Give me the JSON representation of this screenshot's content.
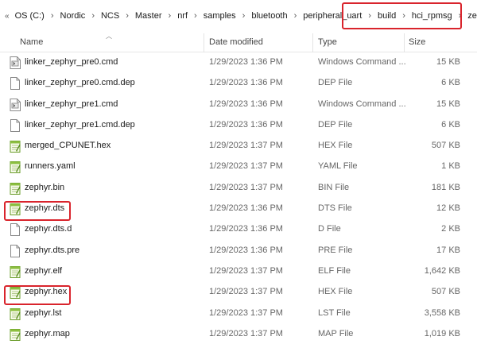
{
  "breadcrumb": {
    "back_glyph": "«",
    "items": [
      "OS (C:)",
      "Nordic",
      "NCS",
      "Master",
      "nrf",
      "samples",
      "bluetooth",
      "peripheral_uart",
      "build",
      "hci_rpmsg",
      "zephyr"
    ]
  },
  "columns": {
    "name": "Name",
    "date": "Date modified",
    "type": "Type",
    "size": "Size"
  },
  "files": [
    {
      "name": "linker_zephyr_pre0.cmd",
      "date": "1/29/2023 1:36 PM",
      "type": "Windows Command ...",
      "size": "15 KB",
      "icon": "cmd-file-icon"
    },
    {
      "name": "linker_zephyr_pre0.cmd.dep",
      "date": "1/29/2023 1:36 PM",
      "type": "DEP File",
      "size": "6 KB",
      "icon": "blank-file-icon"
    },
    {
      "name": "linker_zephyr_pre1.cmd",
      "date": "1/29/2023 1:36 PM",
      "type": "Windows Command ...",
      "size": "15 KB",
      "icon": "cmd-file-icon"
    },
    {
      "name": "linker_zephyr_pre1.cmd.dep",
      "date": "1/29/2023 1:36 PM",
      "type": "DEP File",
      "size": "6 KB",
      "icon": "blank-file-icon"
    },
    {
      "name": "merged_CPUNET.hex",
      "date": "1/29/2023 1:37 PM",
      "type": "HEX File",
      "size": "507 KB",
      "icon": "notepadpp-file-icon"
    },
    {
      "name": "runners.yaml",
      "date": "1/29/2023 1:37 PM",
      "type": "YAML File",
      "size": "1 KB",
      "icon": "notepadpp-file-icon"
    },
    {
      "name": "zephyr.bin",
      "date": "1/29/2023 1:37 PM",
      "type": "BIN File",
      "size": "181 KB",
      "icon": "notepadpp-file-icon"
    },
    {
      "name": "zephyr.dts",
      "date": "1/29/2023 1:36 PM",
      "type": "DTS File",
      "size": "12 KB",
      "icon": "notepadpp-file-icon"
    },
    {
      "name": "zephyr.dts.d",
      "date": "1/29/2023 1:36 PM",
      "type": "D File",
      "size": "2 KB",
      "icon": "blank-file-icon"
    },
    {
      "name": "zephyr.dts.pre",
      "date": "1/29/2023 1:36 PM",
      "type": "PRE File",
      "size": "17 KB",
      "icon": "blank-file-icon"
    },
    {
      "name": "zephyr.elf",
      "date": "1/29/2023 1:37 PM",
      "type": "ELF File",
      "size": "1,642 KB",
      "icon": "notepadpp-file-icon"
    },
    {
      "name": "zephyr.hex",
      "date": "1/29/2023 1:37 PM",
      "type": "HEX File",
      "size": "507 KB",
      "icon": "notepadpp-file-icon"
    },
    {
      "name": "zephyr.lst",
      "date": "1/29/2023 1:37 PM",
      "type": "LST File",
      "size": "3,558 KB",
      "icon": "notepadpp-file-icon"
    },
    {
      "name": "zephyr.map",
      "date": "1/29/2023 1:37 PM",
      "type": "MAP File",
      "size": "1,019 KB",
      "icon": "notepadpp-file-icon"
    }
  ],
  "colors": {
    "highlight": "#d9242c",
    "secondary_text": "#666666"
  }
}
